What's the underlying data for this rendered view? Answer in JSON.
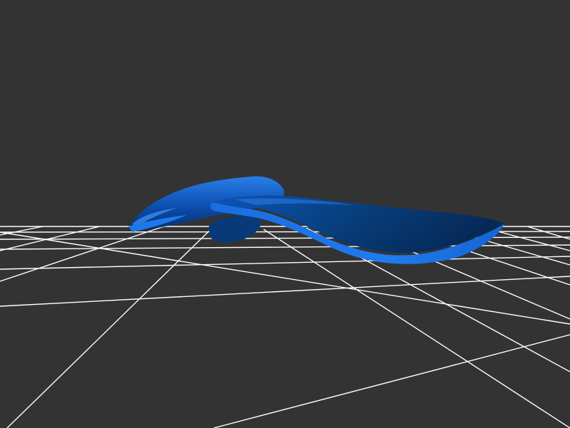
{
  "viewport": {
    "background_color": "#333333",
    "grid_color": "#ffffff",
    "model_color": "#1e6fd6",
    "model_shadow_color": "#0a3a7a",
    "model_highlight_color": "#3f95ff"
  },
  "scene": {
    "ground": "grid-plane",
    "object": "blue-3d-model"
  }
}
